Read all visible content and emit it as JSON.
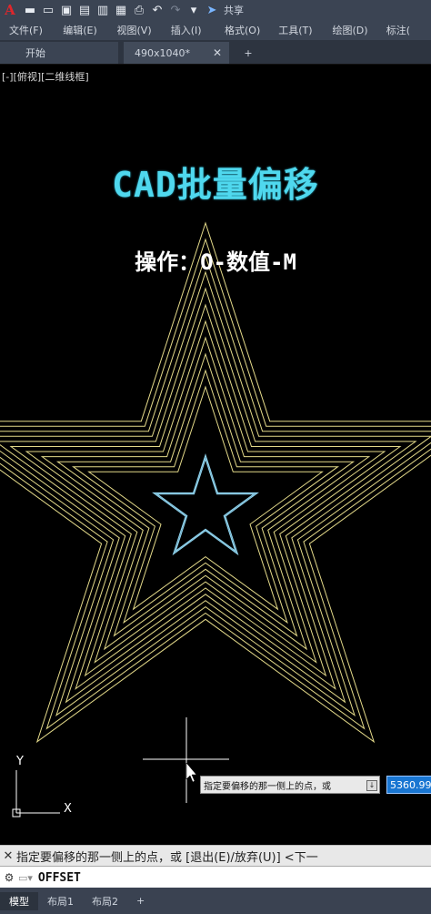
{
  "titlebar": {
    "app_icon": "A",
    "tools": [
      "new-icon",
      "open-icon",
      "save-icon",
      "save-as-icon",
      "publish-icon",
      "plot-icon",
      "undo-icon",
      "redo-icon",
      "customize-icon"
    ],
    "share_label": "共享"
  },
  "menu": {
    "items": [
      "文件(F)",
      "编辑(E)",
      "视图(V)",
      "插入(I)",
      "格式(O)",
      "工具(T)",
      "绘图(D)",
      "标注("
    ]
  },
  "tabs": {
    "start_label": "开始",
    "drawing_label": "490x1040*",
    "close_glyph": "✕",
    "add_glyph": "+"
  },
  "viewport": {
    "label": "[-][俯视][二维线框]"
  },
  "overlay": {
    "title": "CAD批量偏移",
    "subtitle": "操作：O-数值-M"
  },
  "drawing": {
    "offset_line_color": "#e3d989",
    "inner_star_color": "#8fd3ee",
    "ucs_color": "#ffffff",
    "offset_count": 11
  },
  "prompt": {
    "tooltip": "指定要偏移的那一侧上的点，或",
    "tooltip_button": "↓",
    "dynamic_value": "5360.994"
  },
  "command": {
    "history": "指定要偏移的那一侧上的点，或 [退出(E)/放弃(U)] <下一",
    "close_glyph": "✕",
    "wrench_glyph": "🔧",
    "current": "OFFSET"
  },
  "status": {
    "tabs": [
      "模型",
      "布局1",
      "布局2"
    ],
    "add_glyph": "+"
  },
  "ucs": {
    "x_label": "X",
    "y_label": "Y"
  }
}
